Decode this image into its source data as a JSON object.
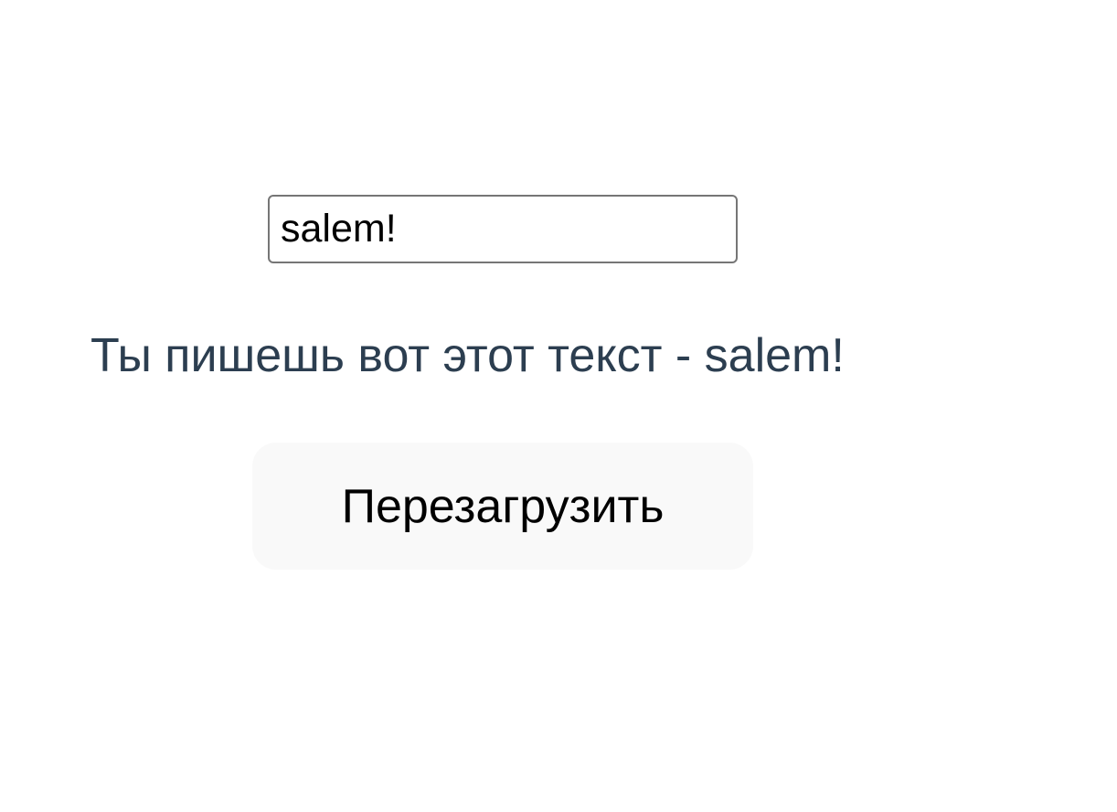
{
  "input": {
    "value": "salem!"
  },
  "output": {
    "text": "Ты пишешь вот этот текст - salem!"
  },
  "reload_button": {
    "label": "Перезагрузить"
  },
  "colors": {
    "output_text": "#2c3e50",
    "button_background": "#f9f9f9",
    "input_border": "#767676"
  }
}
